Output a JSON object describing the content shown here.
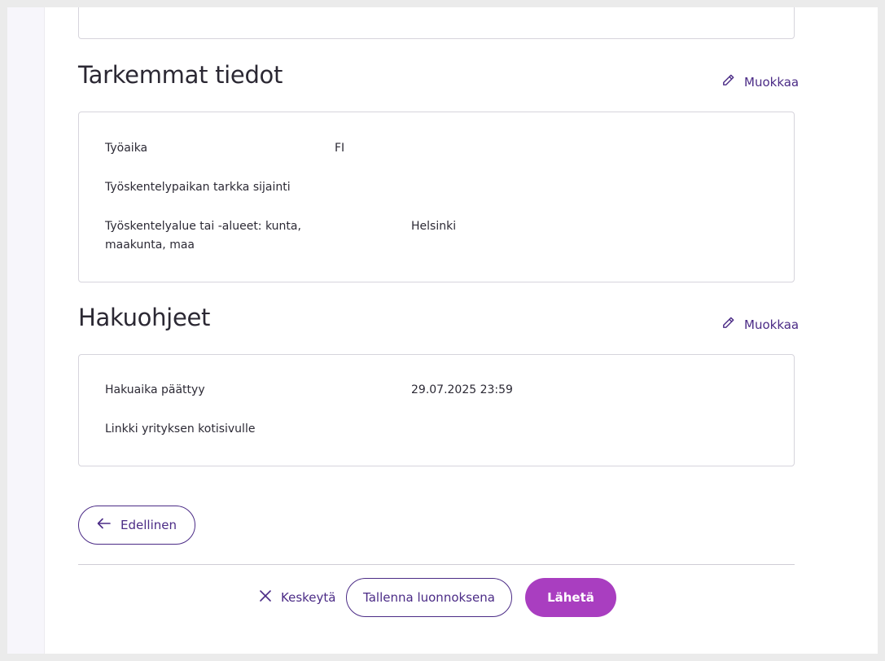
{
  "sections": {
    "details": {
      "title": "Tarkemmat tiedot",
      "edit_label": "Muokkaa",
      "rows": [
        {
          "label": "Työaika",
          "value": "FI"
        },
        {
          "label": "Työskentelypaikan tarkka sijainti",
          "value": ""
        },
        {
          "label_line1": "Työskentelyalue tai -alueet: kunta,",
          "label_line2": "maakunta, maa",
          "value": "Helsinki"
        }
      ]
    },
    "instructions": {
      "title": "Hakuohjeet",
      "edit_label": "Muokkaa",
      "rows": [
        {
          "label": "Hakuaika päättyy",
          "value": "29.07.2025 23:59"
        },
        {
          "label": "Linkki yrityksen kotisivulle",
          "value": ""
        }
      ]
    }
  },
  "footer": {
    "prev_label": "Edellinen",
    "cancel_label": "Keskeytä",
    "draft_label": "Tallenna luonnoksena",
    "send_label": "Lähetä"
  },
  "icons": {
    "edit": "pencil-icon",
    "prev": "arrow-left-icon",
    "cancel": "close-icon"
  },
  "colors": {
    "accent": "#4b2b86",
    "primary_button": "#a93ec0",
    "border": "#d6d4dc"
  }
}
